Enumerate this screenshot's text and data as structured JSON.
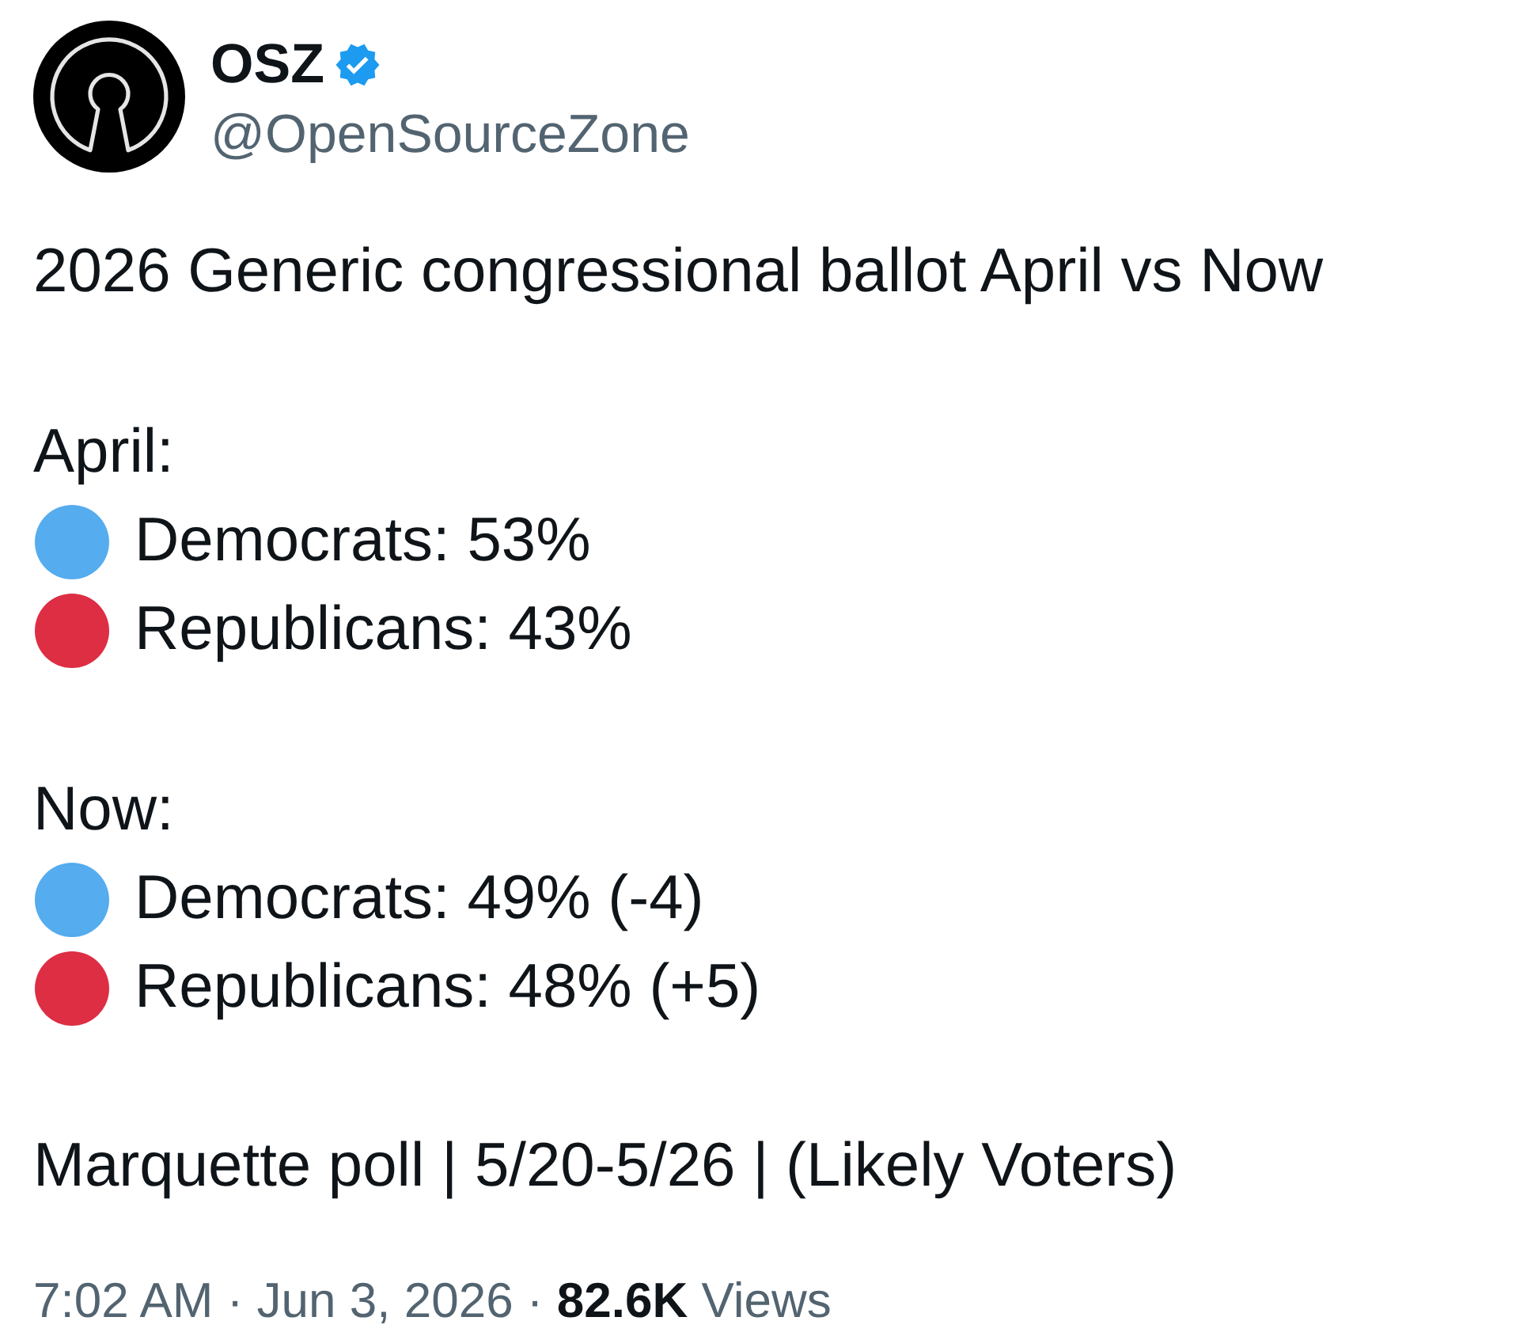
{
  "author": {
    "name": "OSZ",
    "verified": true,
    "handle": "@OpenSourceZone"
  },
  "post": {
    "headline": "2026 Generic congressional ballot April vs Now",
    "sections": [
      {
        "label": "April:",
        "items": [
          {
            "color": "#55acee",
            "text": "Democrats: 53%"
          },
          {
            "color": "#dd2e44",
            "text": "Republicans: 43%"
          }
        ]
      },
      {
        "label": "Now:",
        "items": [
          {
            "color": "#55acee",
            "text": "Democrats: 49% (-4)"
          },
          {
            "color": "#dd2e44",
            "text": "Republicans: 48% (+5)"
          }
        ]
      }
    ],
    "source": "Marquette poll | 5/20-5/26 | (Likely Voters)"
  },
  "meta": "7:02 AM · Jun 3, 2026 · **82.6K** Views"
}
